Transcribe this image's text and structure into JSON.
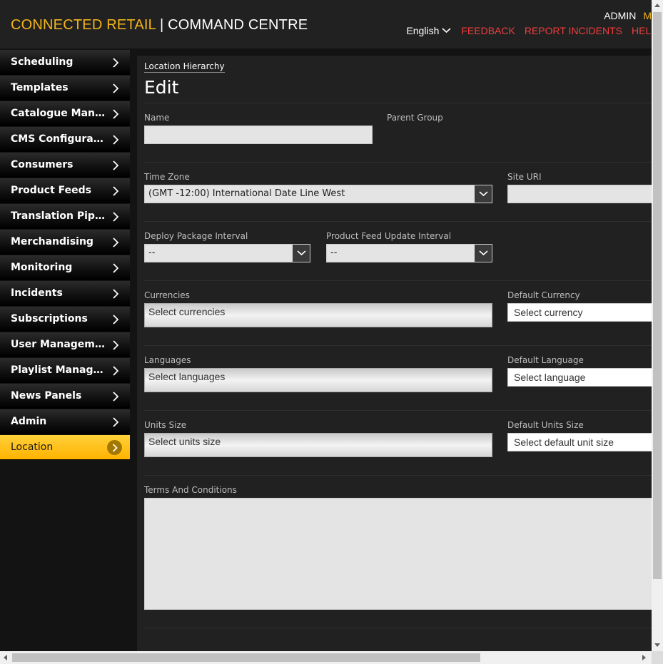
{
  "header": {
    "brand_primary": "CONNECTED RETAIL",
    "brand_separator": " | ",
    "brand_secondary": "COMMAND CENTRE",
    "user": "ADMIN",
    "user_extra": "M",
    "language": "English",
    "links": {
      "feedback": "FEEDBACK",
      "report": "REPORT INCIDENTS",
      "help": "HELP"
    },
    "accent_color": "#f3b51a",
    "link_color": "#f03e3e"
  },
  "sidebar": {
    "items": [
      {
        "label": "Scheduling"
      },
      {
        "label": "Templates"
      },
      {
        "label": "Catalogue Management"
      },
      {
        "label": "CMS Configuration"
      },
      {
        "label": "Consumers"
      },
      {
        "label": "Product Feeds"
      },
      {
        "label": "Translation Pipeline"
      },
      {
        "label": "Merchandising"
      },
      {
        "label": "Monitoring"
      },
      {
        "label": "Incidents"
      },
      {
        "label": "Subscriptions"
      },
      {
        "label": "User Management"
      },
      {
        "label": "Playlist Management"
      },
      {
        "label": "News Panels"
      },
      {
        "label": "Admin"
      },
      {
        "label": "Location",
        "active": true
      }
    ],
    "active_color": "#ffc107"
  },
  "main": {
    "breadcrumb": "Location Hierarchy",
    "title": "Edit",
    "form": {
      "name": {
        "label": "Name",
        "value": ""
      },
      "parent_group": {
        "label": "Parent Group"
      },
      "time_zone": {
        "label": "Time Zone",
        "value": "(GMT -12:00) International Date Line West"
      },
      "site_uri": {
        "label": "Site URI",
        "value": ""
      },
      "deploy_interval": {
        "label": "Deploy Package Interval",
        "value": "--"
      },
      "feed_interval": {
        "label": "Product Feed Update Interval",
        "value": "--"
      },
      "currencies": {
        "label": "Currencies",
        "placeholder": "Select currencies"
      },
      "default_currency": {
        "label": "Default Currency",
        "placeholder": "Select currency"
      },
      "languages": {
        "label": "Languages",
        "placeholder": "Select languages"
      },
      "default_language": {
        "label": "Default Language",
        "placeholder": "Select language"
      },
      "units_size": {
        "label": "Units Size",
        "placeholder": "Select units size"
      },
      "default_units_size": {
        "label": "Default Units Size",
        "placeholder": "Select default unit size"
      },
      "terms": {
        "label": "Terms And Conditions",
        "value": ""
      }
    }
  }
}
